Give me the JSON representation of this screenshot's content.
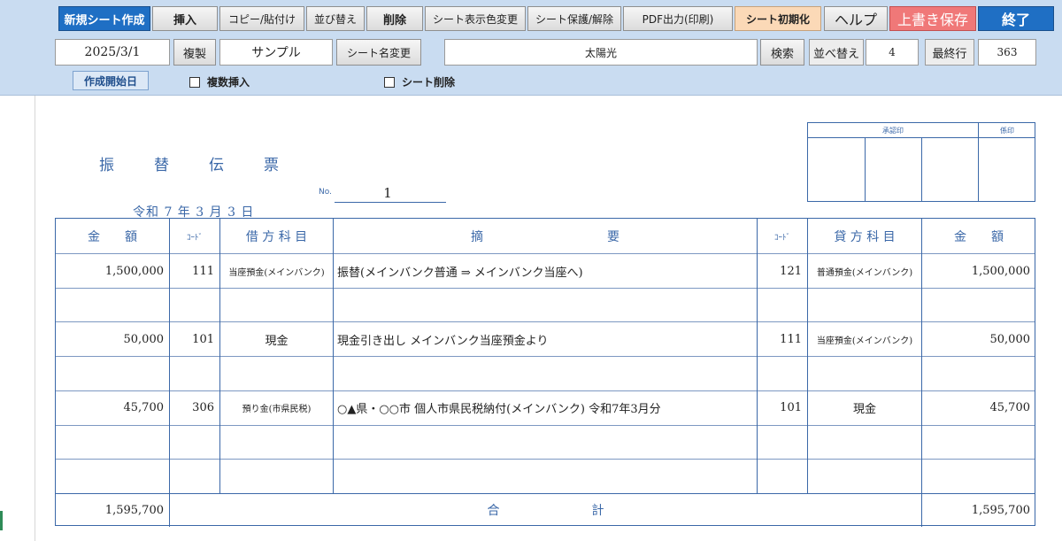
{
  "toolbar": {
    "new_sheet": "新規シート作成",
    "insert": "挿入",
    "copy_paste": "コピー/貼付け",
    "sort": "並び替え",
    "delete": "削除",
    "sheet_color": "シート表示色変更",
    "sheet_protect": "シート保護/解除",
    "pdf_output": "PDF出力(印刷)",
    "sheet_init": "シート初期化",
    "help": "ヘルプ",
    "overwrite_save": "上書き保存",
    "exit": "終了"
  },
  "controls": {
    "date_value": "2025/3/1",
    "duplicate": "複製",
    "sheet_name_value": "サンプル",
    "rename_sheet": "シート名変更",
    "search_value": "太陽光",
    "search": "検索",
    "sort_label": "並べ替え",
    "sort_value": "4",
    "last_row_label": "最終行",
    "last_row_value": "363",
    "start_date_tag": "作成開始日",
    "multi_insert": "複数挿入",
    "sheet_delete": "シート削除"
  },
  "voucher": {
    "title_chars": [
      "振",
      "替",
      "伝",
      "票"
    ],
    "no_label": "No.",
    "no_value": "1",
    "date": "令和 7 年 3 月 3 日",
    "stamps": {
      "approval": "承認印",
      "staff": "係印"
    },
    "headers": {
      "debit_amount": "金　　額",
      "debit_code": "ｺｰﾄﾞ",
      "debit_account": "借 方 科 目",
      "summary": "摘　　　　　　　　　　要",
      "credit_code": "ｺｰﾄﾞ",
      "credit_account": "貸 方 科 目",
      "credit_amount": "金　　額"
    },
    "rows": [
      {
        "debit_amount": "1,500,000",
        "debit_code": "111",
        "debit_account": "当座預金(メインバンク)",
        "summary": "振替(メインバンク普通 ⇒ メインバンク当座へ)",
        "credit_code": "121",
        "credit_account": "普通預金(メインバンク)",
        "credit_amount": "1,500,000"
      },
      {
        "debit_amount": "",
        "debit_code": "",
        "debit_account": "",
        "summary": "",
        "credit_code": "",
        "credit_account": "",
        "credit_amount": ""
      },
      {
        "debit_amount": "50,000",
        "debit_code": "101",
        "debit_account": "現金",
        "summary": "現金引き出し メインバンク当座預金より",
        "credit_code": "111",
        "credit_account": "当座預金(メインバンク)",
        "credit_amount": "50,000"
      },
      {
        "debit_amount": "",
        "debit_code": "",
        "debit_account": "",
        "summary": "",
        "credit_code": "",
        "credit_account": "",
        "credit_amount": ""
      },
      {
        "debit_amount": "45,700",
        "debit_code": "306",
        "debit_account": "預り金(市県民税)",
        "summary": "○▲県・○○市 個人市県民税納付(メインバンク) 令和7年3月分",
        "credit_code": "101",
        "credit_account": "現金",
        "credit_amount": "45,700"
      },
      {
        "debit_amount": "",
        "debit_code": "",
        "debit_account": "",
        "summary": "",
        "credit_code": "",
        "credit_account": "",
        "credit_amount": ""
      },
      {
        "debit_amount": "",
        "debit_code": "",
        "debit_account": "",
        "summary": "",
        "credit_code": "",
        "credit_account": "",
        "credit_amount": ""
      }
    ],
    "total": {
      "label_chars": [
        "合",
        "計"
      ],
      "debit": "1,595,700",
      "credit": "1,595,700"
    }
  }
}
